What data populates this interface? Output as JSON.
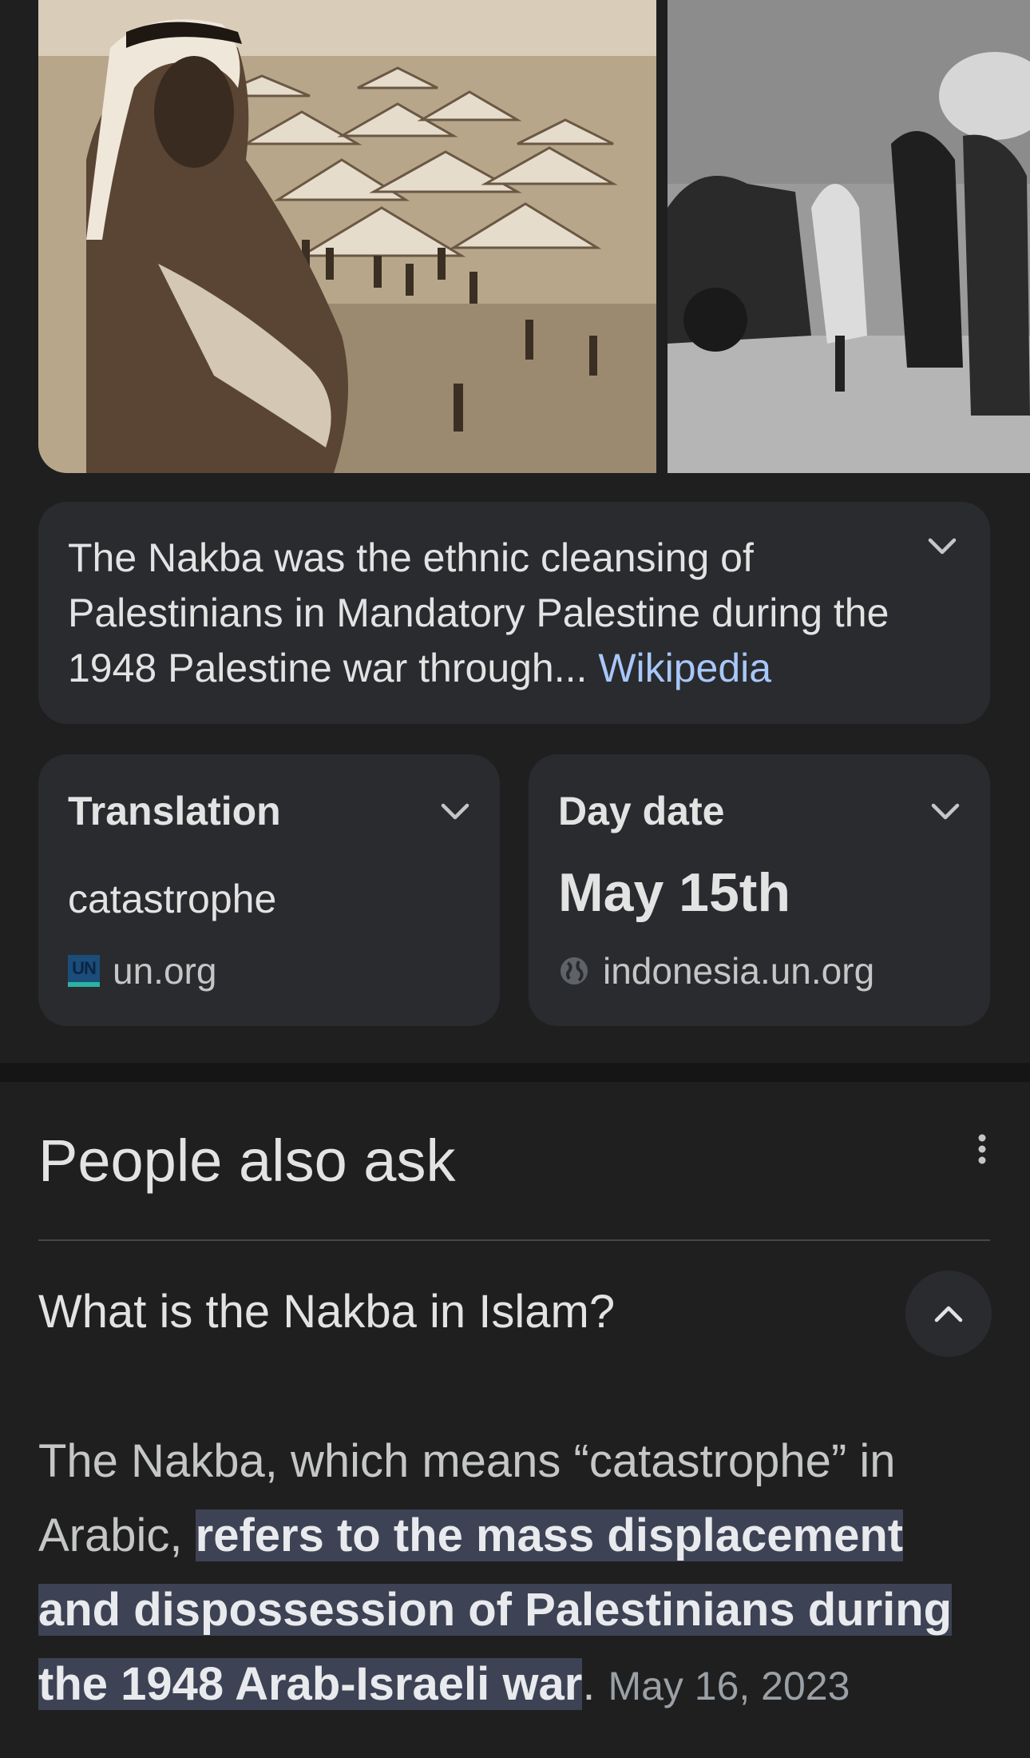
{
  "summary": {
    "text": "The Nakba was the ethnic cleansing of Palestinians in Mandatory Palestine during the 1948 Palestine war throug​h...",
    "text_main": "The Nakba was the ethnic cleansing of Palestinians in Mandatory Palestine during the 1948 Palestine war through",
    "ellipsis": "...",
    "source_link": "Wikipedia"
  },
  "facts": [
    {
      "label": "Translation",
      "value": "catastrophe",
      "source": "un.org",
      "source_icon": "un-logo-icon"
    },
    {
      "label": "Day date",
      "value": "May 15th",
      "source": "indonesia.un.org",
      "source_icon": "globe-icon"
    }
  ],
  "un_logo_text": "UN",
  "people_also_ask": {
    "title": "People also ask",
    "question": "What is the Nakba in Islam?",
    "answer_plain": "The Nakba, which means “catastrophe” in Arabic, ",
    "answer_highlight": "refers to the mass displacement and dispossession of Palestinians during the 1948 Arab-Israeli war",
    "answer_end": ".",
    "answer_date": "May 16, 2023"
  },
  "colors": {
    "background": "#1f1f1f",
    "card": "#2a2b2e",
    "link": "#a8c7fa",
    "highlight": "#3d4354"
  }
}
